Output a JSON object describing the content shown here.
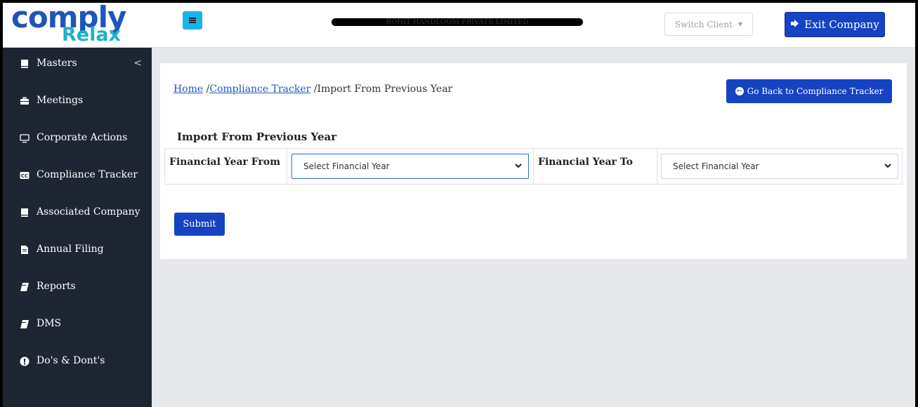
{
  "logo": {
    "main": "comply",
    "sub": "Relax"
  },
  "sidebar": {
    "items": [
      {
        "label": "Masters",
        "icon": "ledger-icon",
        "chevron": "<"
      },
      {
        "label": "Meetings",
        "icon": "briefcase-icon"
      },
      {
        "label": "Corporate Actions",
        "icon": "monitor-icon"
      },
      {
        "label": "Compliance Tracker",
        "icon": "cc-icon"
      },
      {
        "label": "Associated Company",
        "icon": "ledger-icon"
      },
      {
        "label": "Annual Filing",
        "icon": "file-icon"
      },
      {
        "label": "Reports",
        "icon": "book-icon"
      },
      {
        "label": "DMS",
        "icon": "book-icon"
      },
      {
        "label": "Do's & Dont's",
        "icon": "exclamation-icon"
      }
    ]
  },
  "header": {
    "company_name": "ROHIT HANDLOOM PRIVATE LIMITED",
    "switch_client": "Switch Client",
    "exit_company": "Exit Company"
  },
  "breadcrumb": {
    "home": "Home",
    "sep1": "/",
    "tracker": "Compliance Tracker",
    "sep2": "/",
    "current": "Import From Previous Year"
  },
  "go_back": "Go Back to Compliance Tracker",
  "form": {
    "title": "Import From Previous Year",
    "from_label": "Financial Year From",
    "from_value": "Select Financial Year",
    "to_label": "Financial Year To",
    "to_value": "Select Financial Year",
    "submit": "Submit"
  },
  "colors": {
    "sidebar_bg": "#1f2633",
    "primary": "#1643c2",
    "menu_toggle": "#18b4e6",
    "page_bg": "#e6e7ea"
  }
}
